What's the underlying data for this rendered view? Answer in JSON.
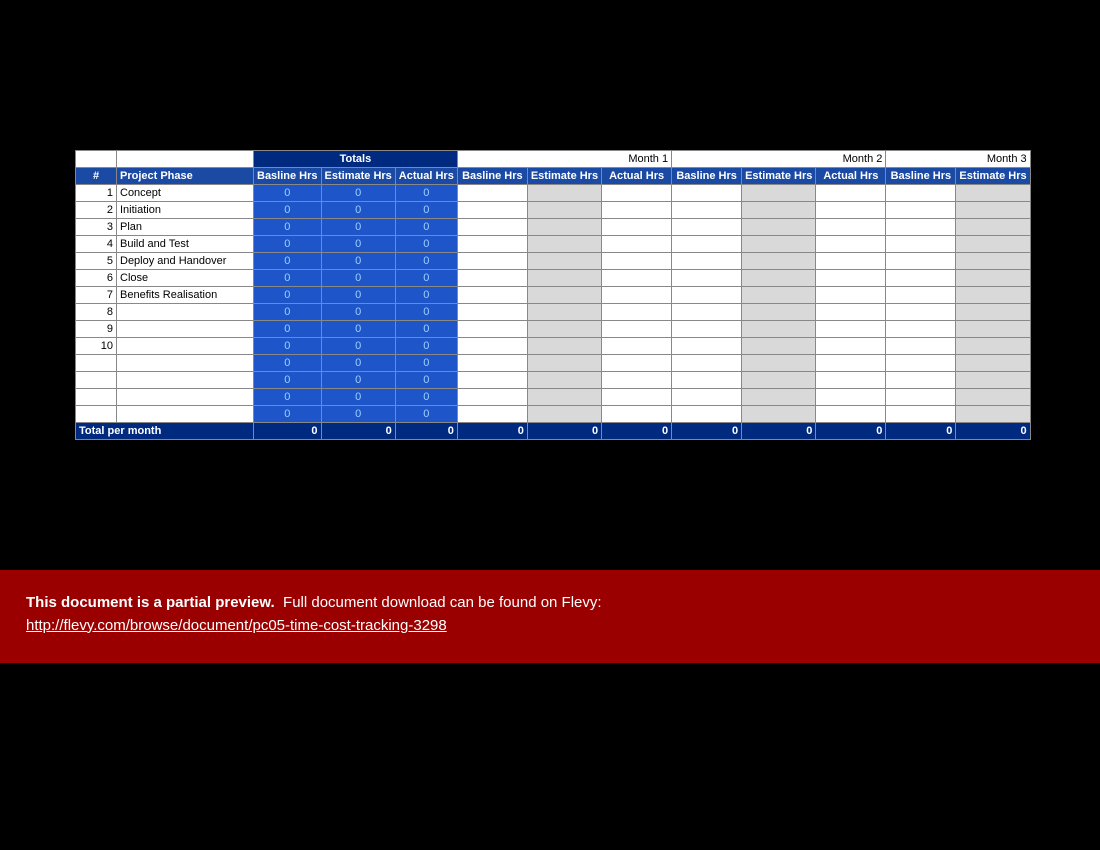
{
  "headers": {
    "num": "#",
    "phase": "Project Phase",
    "totals": "Totals",
    "months": [
      "Month 1",
      "Month 2",
      "Month 3"
    ],
    "cols": {
      "baseline": "Basline Hrs",
      "estimate": "Estimate Hrs",
      "actual": "Actual Hrs"
    }
  },
  "rows": [
    {
      "num": "1",
      "phase": "Concept",
      "t": [
        "0",
        "0",
        "0"
      ]
    },
    {
      "num": "2",
      "phase": "Initiation",
      "t": [
        "0",
        "0",
        "0"
      ]
    },
    {
      "num": "3",
      "phase": "Plan",
      "t": [
        "0",
        "0",
        "0"
      ]
    },
    {
      "num": "4",
      "phase": "Build and Test",
      "t": [
        "0",
        "0",
        "0"
      ]
    },
    {
      "num": "5",
      "phase": "Deploy and Handover",
      "t": [
        "0",
        "0",
        "0"
      ]
    },
    {
      "num": "6",
      "phase": "Close",
      "t": [
        "0",
        "0",
        "0"
      ]
    },
    {
      "num": "7",
      "phase": "Benefits Realisation",
      "t": [
        "0",
        "0",
        "0"
      ]
    },
    {
      "num": "8",
      "phase": "",
      "t": [
        "0",
        "0",
        "0"
      ]
    },
    {
      "num": "9",
      "phase": "",
      "t": [
        "0",
        "0",
        "0"
      ]
    },
    {
      "num": "10",
      "phase": "",
      "t": [
        "0",
        "0",
        "0"
      ]
    },
    {
      "num": "",
      "phase": "",
      "t": [
        "0",
        "0",
        "0"
      ]
    },
    {
      "num": "",
      "phase": "",
      "t": [
        "0",
        "0",
        "0"
      ]
    },
    {
      "num": "",
      "phase": "",
      "t": [
        "0",
        "0",
        "0"
      ]
    },
    {
      "num": "",
      "phase": "",
      "t": [
        "0",
        "0",
        "0"
      ]
    }
  ],
  "footer_row": {
    "label": "Total per month",
    "totals": [
      "0",
      "0",
      "0"
    ],
    "months": [
      [
        "0",
        "0",
        "0"
      ],
      [
        "0",
        "0",
        "0"
      ],
      [
        "0",
        "0"
      ]
    ]
  },
  "banner": {
    "bold": "This document is a partial preview.",
    "rest": "Full document download can be found on Flevy:",
    "link": "http://flevy.com/browse/document/pc05-time-cost-tracking-3298"
  }
}
